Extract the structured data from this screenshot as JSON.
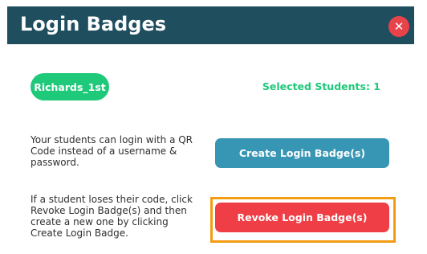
{
  "header": {
    "title": "Login Badges",
    "close_glyph": "✕",
    "close_icon": "close-icon"
  },
  "student": {
    "name": "Richards_1st"
  },
  "selection": {
    "label": "Selected Students: 1"
  },
  "create_section": {
    "description": "Your students can login with a QR Code instead of a username & password.",
    "button_label": "Create Login Badge(s)"
  },
  "revoke_section": {
    "description": "If a student loses their code, click Revoke Login Badge(s) and then create a new one by clicking Create Login Badge.",
    "button_label": "Revoke Login Badge(s)"
  },
  "colors": {
    "header_bg": "#1f4e5f",
    "close_bg": "#e8424a",
    "chip_bg": "#1ec97a",
    "selected_text": "#1ec97a",
    "create_bg": "#3896b5",
    "revoke_bg": "#ef3e45",
    "highlight": "#f39c12"
  }
}
